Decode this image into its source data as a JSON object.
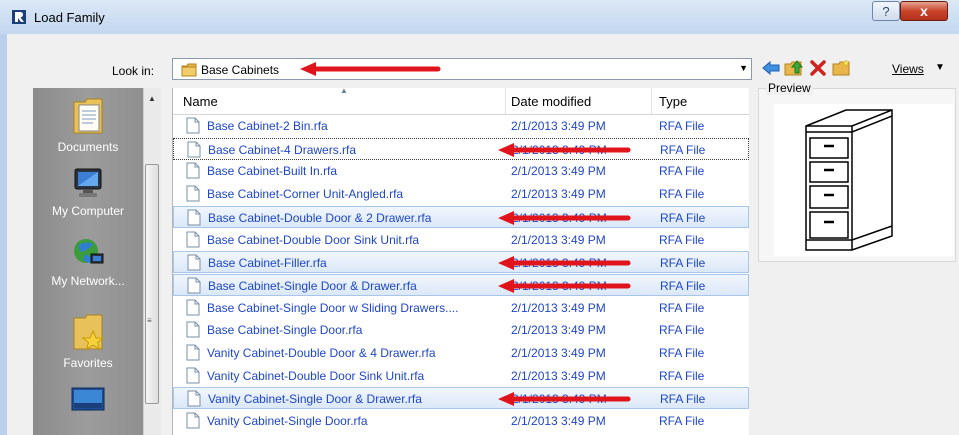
{
  "window": {
    "title": "Load Family",
    "help_glyph": "?",
    "close_glyph": "x"
  },
  "toolbar": {
    "look_in_label": "Look in:",
    "look_in_value": "Base Cabinets",
    "views_label": "Views",
    "icons": [
      "back-arrow-icon",
      "up-folder-icon",
      "delete-icon",
      "new-folder-icon",
      "views-icon"
    ]
  },
  "places": [
    {
      "label": "Documents",
      "icon": "documents-icon"
    },
    {
      "label": "My Computer",
      "icon": "my-computer-icon"
    },
    {
      "label": "My Network...",
      "icon": "my-network-icon"
    },
    {
      "label": "Favorites",
      "icon": "favorites-icon"
    },
    {
      "label": "",
      "icon": "desktop-icon"
    }
  ],
  "columns": {
    "name": "Name",
    "date": "Date modified",
    "type": "Type"
  },
  "files": [
    {
      "name": "Base Cabinet-2 Bin.rfa",
      "date": "2/1/2013 3:49 PM",
      "type": "RFA File",
      "state": "none"
    },
    {
      "name": "Base Cabinet-4 Drawers.rfa",
      "date": "2/1/2013 3:49 PM",
      "type": "RFA File",
      "state": "focus"
    },
    {
      "name": "Base Cabinet-Built In.rfa",
      "date": "2/1/2013 3:49 PM",
      "type": "RFA File",
      "state": "none"
    },
    {
      "name": "Base Cabinet-Corner Unit-Angled.rfa",
      "date": "2/1/2013 3:49 PM",
      "type": "RFA File",
      "state": "none"
    },
    {
      "name": "Base Cabinet-Double Door & 2 Drawer.rfa",
      "date": "2/1/2013 3:49 PM",
      "type": "RFA File",
      "state": "selected"
    },
    {
      "name": "Base Cabinet-Double Door Sink Unit.rfa",
      "date": "2/1/2013 3:49 PM",
      "type": "RFA File",
      "state": "none"
    },
    {
      "name": "Base Cabinet-Filler.rfa",
      "date": "2/1/2013 3:49 PM",
      "type": "RFA File",
      "state": "selected"
    },
    {
      "name": "Base Cabinet-Single Door & Drawer.rfa",
      "date": "2/1/2013 3:49 PM",
      "type": "RFA File",
      "state": "selected"
    },
    {
      "name": "Base Cabinet-Single Door w Sliding Drawers....",
      "date": "2/1/2013 3:49 PM",
      "type": "RFA File",
      "state": "none"
    },
    {
      "name": "Base Cabinet-Single Door.rfa",
      "date": "2/1/2013 3:49 PM",
      "type": "RFA File",
      "state": "none"
    },
    {
      "name": "Vanity Cabinet-Double Door & 4 Drawer.rfa",
      "date": "2/1/2013 3:49 PM",
      "type": "RFA File",
      "state": "none"
    },
    {
      "name": "Vanity Cabinet-Double Door Sink Unit.rfa",
      "date": "2/1/2013 3:49 PM",
      "type": "RFA File",
      "state": "none"
    },
    {
      "name": "Vanity Cabinet-Single Door & Drawer.rfa",
      "date": "2/1/2013 3:49 PM",
      "type": "RFA File",
      "state": "selected"
    },
    {
      "name": "Vanity Cabinet-Single Door.rfa",
      "date": "2/1/2013 3:49 PM",
      "type": "RFA File",
      "state": "none"
    }
  ],
  "preview": {
    "label": "Preview"
  },
  "colors": {
    "annotation_arrow": "#e0141b",
    "link_text": "#1e46c8",
    "selection": "#dbe8f8"
  }
}
